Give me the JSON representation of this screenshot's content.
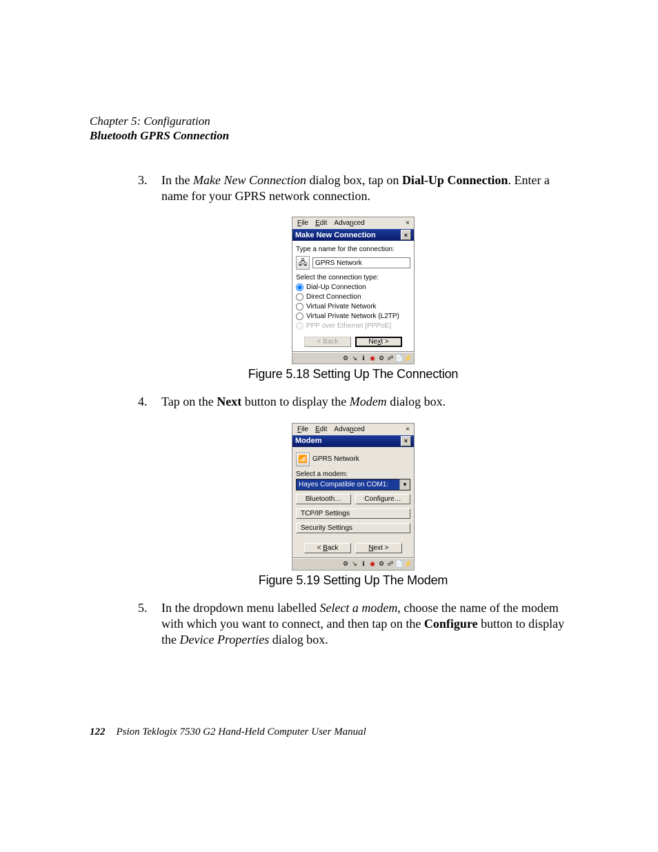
{
  "header": {
    "chapter_line": "Chapter 5: Configuration",
    "subtitle": "Bluetooth GPRS Connection"
  },
  "steps": {
    "s3": {
      "num": "3.",
      "pre": "In the ",
      "em1": "Make New Connection",
      "mid1": " dialog box, tap on ",
      "bold1": "Dial-Up Connection",
      "tail": ". Enter a name for your GPRS network connection."
    },
    "s4": {
      "num": "4.",
      "pre": "Tap on the ",
      "bold1": "Next",
      "mid1": " button to display the ",
      "em1": "Modem",
      "tail": " dialog box."
    },
    "s5": {
      "num": "5.",
      "pre": "In the dropdown menu labelled ",
      "em1": "Select a modem",
      "mid1": ", choose the name of the modem with which you want to connect, and then tap on the ",
      "bold1": "Configure",
      "mid2": " button to display the ",
      "em2": "Device Properties",
      "tail": " dialog box."
    }
  },
  "captions": {
    "c18": "Figure 5.18 Setting Up The Connection",
    "c19": "Figure 5.19 Setting Up The Modem"
  },
  "win1": {
    "menu": {
      "file": "File",
      "edit": "Edit",
      "advanced": "Advanced"
    },
    "title": "Make New Connection",
    "label_name": "Type a name for the connection:",
    "input_value": "GPRS Network",
    "label_type": "Select the connection type:",
    "radios": {
      "r1": "Dial-Up Connection",
      "r2": "Direct Connection",
      "r3": "Virtual Private Network",
      "r4": "Virtual Private Network (L2TP)",
      "r5": "PPP over Ethernet [PPPoE]"
    },
    "back": "< Back",
    "next_pre": "Ne",
    "next_u": "x",
    "next_post": "t >"
  },
  "win2": {
    "menu": {
      "file": "File",
      "edit": "Edit",
      "advanced": "Advanced"
    },
    "title": "Modem",
    "network_name": "GPRS Network",
    "label_select": "Select a modem:",
    "dropdown": "Hayes Compatible on COM1:",
    "bluetooth_pre": "Bl",
    "bluetooth_u": "u",
    "bluetooth_post": "etooth…",
    "configure_pre": "",
    "configure_u": "C",
    "configure_post": "onfigure…",
    "tcpip_u": "T",
    "tcpip_post": "CP/IP Settings",
    "security_u": "S",
    "security_post": "ecurity Settings",
    "back_pre": "< ",
    "back_u": "B",
    "back_post": "ack",
    "next_u": "N",
    "next_post": "ext >"
  },
  "footer": {
    "page": "122",
    "text": "Psion Teklogix 7530 G2 Hand-Held Computer User Manual"
  }
}
